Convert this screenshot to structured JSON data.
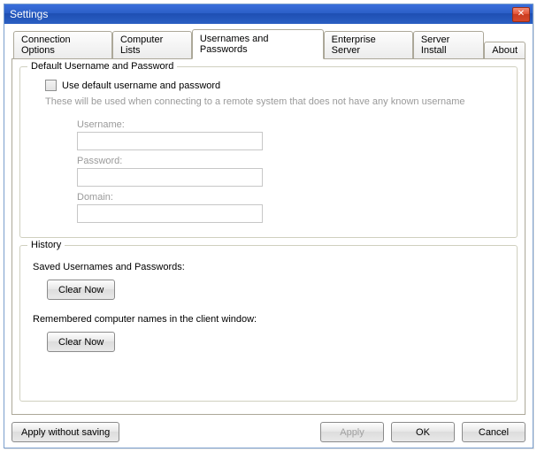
{
  "window": {
    "title": "Settings"
  },
  "tabs": [
    {
      "label": "Connection Options"
    },
    {
      "label": "Computer Lists"
    },
    {
      "label": "Usernames and Passwords"
    },
    {
      "label": "Enterprise Server"
    },
    {
      "label": "Server Install"
    },
    {
      "label": "About"
    }
  ],
  "group_default": {
    "legend": "Default Username and Password",
    "checkbox_label": "Use default username and password",
    "hint": "These will be used when connecting to a remote system that does not have any known username",
    "username_label": "Username:",
    "username_value": "",
    "password_label": "Password:",
    "password_value": "",
    "domain_label": "Domain:",
    "domain_value": ""
  },
  "group_history": {
    "legend": "History",
    "saved_label": "Saved Usernames and Passwords:",
    "clear_saved_label": "Clear Now",
    "remembered_label": "Remembered computer names in the client window:",
    "clear_remembered_label": "Clear Now"
  },
  "footer": {
    "apply_without_saving": "Apply without saving",
    "apply": "Apply",
    "ok": "OK",
    "cancel": "Cancel"
  }
}
